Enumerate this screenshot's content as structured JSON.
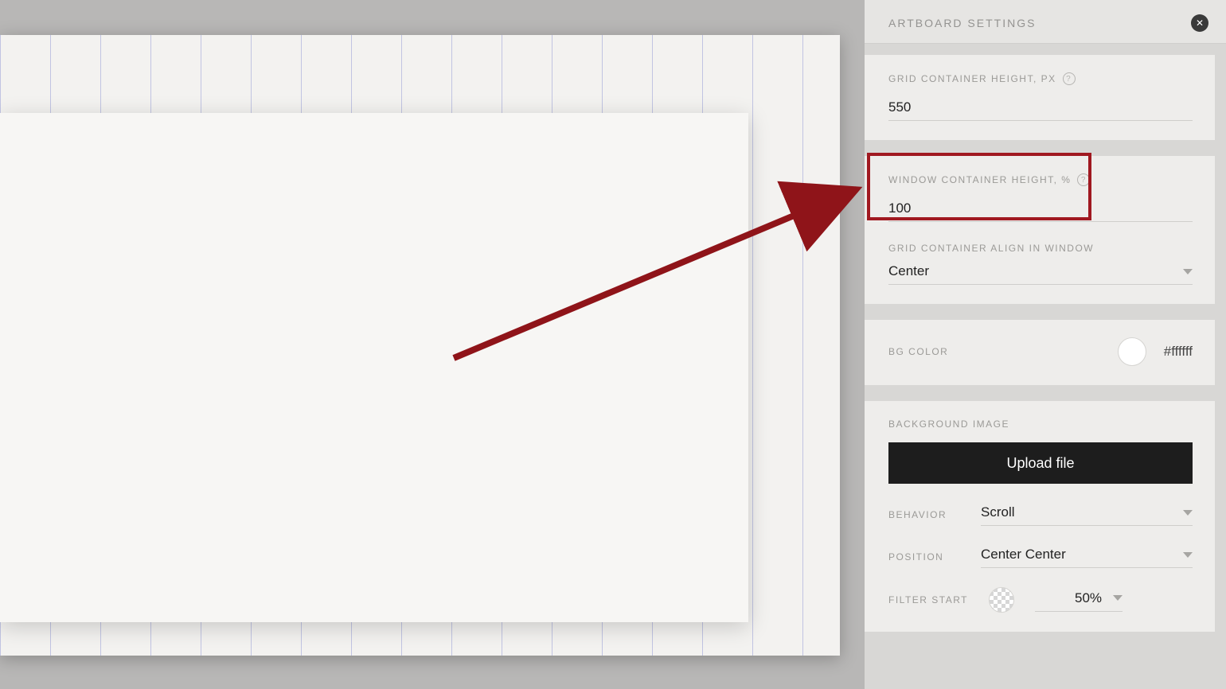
{
  "panel": {
    "title": "ARTBOARD SETTINGS",
    "grid_height": {
      "label": "GRID CONTAINER HEIGHT, PX",
      "value": "550"
    },
    "window_height": {
      "label": "WINDOW CONTAINER HEIGHT, %",
      "value": "100"
    },
    "grid_align": {
      "label": "GRID CONTAINER ALIGN IN WINDOW",
      "value": "Center"
    },
    "bg_color": {
      "label": "BG COLOR",
      "hex": "#ffffff"
    },
    "bg_image": {
      "label": "BACKGROUND IMAGE",
      "upload_label": "Upload file"
    },
    "behavior": {
      "label": "BEHAVIOR",
      "value": "Scroll"
    },
    "position": {
      "label": "POSITION",
      "value": "Center Center"
    },
    "filter_start": {
      "label": "FILTER START",
      "value": "50%"
    }
  },
  "annotation": {
    "highlight_target": "window-container-height-field"
  }
}
